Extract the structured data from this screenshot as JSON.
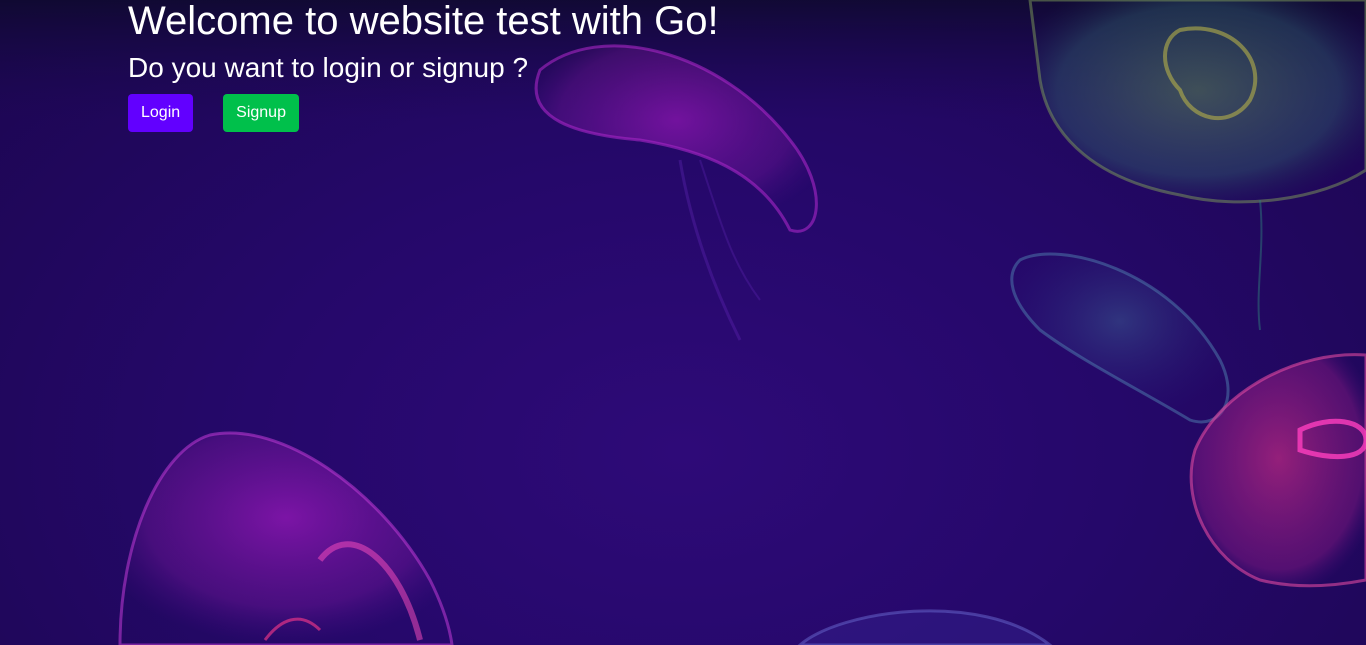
{
  "page": {
    "title": "Welcome to website test with Go!",
    "subtitle": "Do you want to login or signup ?"
  },
  "actions": {
    "login_label": "Login",
    "signup_label": "Signup"
  },
  "colors": {
    "login_button": "#6200ff",
    "signup_button": "#00c04b",
    "background": "#2a0a66"
  }
}
